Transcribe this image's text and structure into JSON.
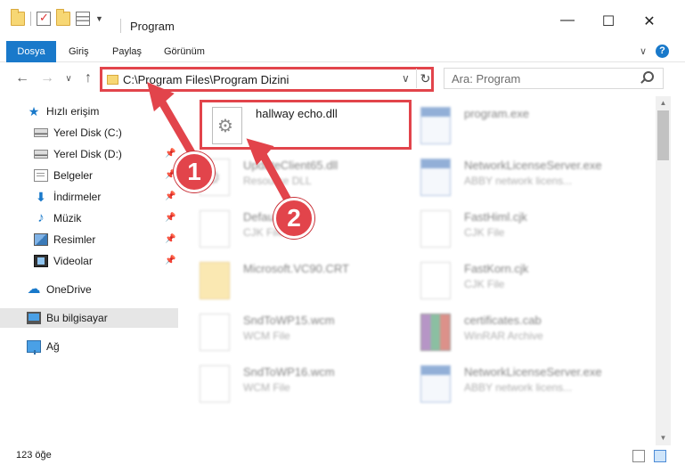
{
  "window": {
    "title": "Program",
    "minimize": "—",
    "maximize": "☐",
    "close": "✕"
  },
  "ribbon": {
    "tabs": [
      "Dosya",
      "Giriş",
      "Paylaş",
      "Görünüm"
    ],
    "help": "?"
  },
  "navigation": {
    "address_path": "C:\\Program Files\\Program Dizini",
    "search_placeholder": "Ara: Program"
  },
  "sidebar": {
    "items": [
      {
        "label": "Hızlı erişim",
        "icon": "star-icon"
      },
      {
        "label": "Yerel Disk (C:)",
        "icon": "disk-icon"
      },
      {
        "label": "Yerel Disk (D:)",
        "icon": "disk-icon"
      },
      {
        "label": "Belgeler",
        "icon": "documents-icon"
      },
      {
        "label": "İndirmeler",
        "icon": "downloads-icon"
      },
      {
        "label": "Müzik",
        "icon": "music-icon"
      },
      {
        "label": "Resimler",
        "icon": "pictures-icon"
      },
      {
        "label": "Videolar",
        "icon": "videos-icon"
      },
      {
        "label": "OneDrive",
        "icon": "cloud-icon"
      },
      {
        "label": "Bu bilgisayar",
        "icon": "computer-icon"
      },
      {
        "label": "Ağ",
        "icon": "network-icon"
      }
    ],
    "selected": "Bu bilgisayar"
  },
  "files": {
    "highlighted": {
      "name": "hallway echo.dll",
      "type": ""
    },
    "items": [
      {
        "name": "program.exe",
        "type": ""
      },
      {
        "name": "UpdateClient65.dll",
        "type": "Resource DLL"
      },
      {
        "name": "NetworkLicenseServer.exe",
        "type": "ABBY network licens..."
      },
      {
        "name": "Default.cjk",
        "type": "CJK File"
      },
      {
        "name": "FastHiml.cjk",
        "type": "CJK File"
      },
      {
        "name": "Microsoft.VC90.CRT",
        "type": ""
      },
      {
        "name": "FastKorn.cjk",
        "type": "CJK File"
      },
      {
        "name": "SndToWP15.wcm",
        "type": "WCM File"
      },
      {
        "name": "certificates.cab",
        "type": "WinRAR Archive"
      },
      {
        "name": "SndToWP16.wcm",
        "type": "WCM File"
      },
      {
        "name": "NetworkLicenseServer.exe",
        "type": "ABBY network licens..."
      }
    ]
  },
  "annotations": {
    "step1": "1",
    "step2": "2"
  },
  "status": {
    "item_count": "123 öğe"
  },
  "colors": {
    "accent": "#1979ca",
    "annotation_red": "#e2444b"
  }
}
